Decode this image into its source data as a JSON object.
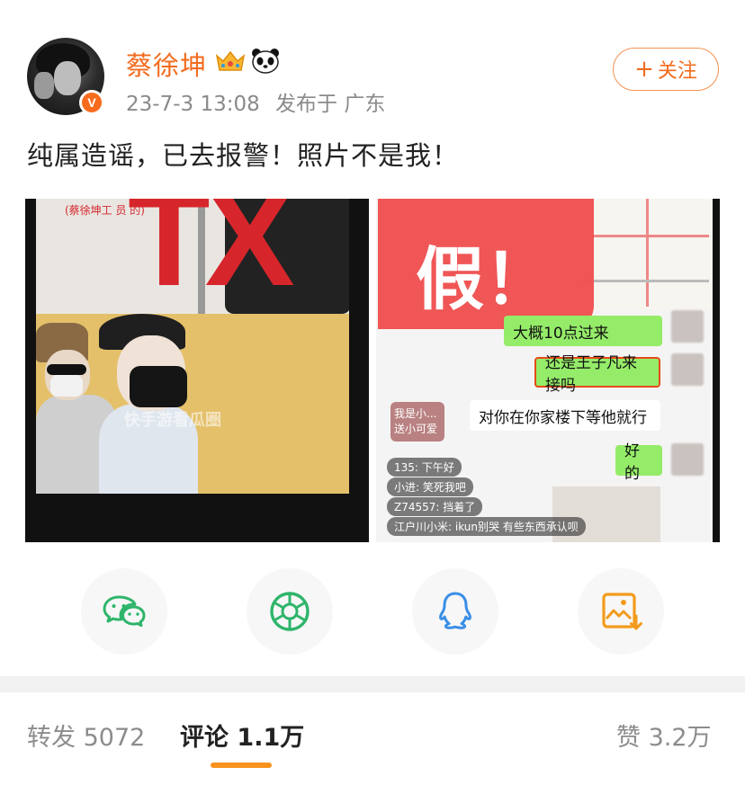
{
  "post": {
    "user": {
      "name": "蔡徐坤",
      "verified_badge": "V",
      "icons": [
        "crown-icon",
        "panda-icon"
      ]
    },
    "timestamp": "23-7-3 13:08",
    "location": "发布于 广东",
    "follow_label": "关注",
    "text": "纯属造谣，已去报警！照片不是我！",
    "images": {
      "image1": {
        "overlay_text": "TX",
        "caption": "(蔡徐坤工    员         的)",
        "watermark": "快手游看瓜圈"
      },
      "image2": {
        "overlay_text": "假！",
        "chat": {
          "green1": "大概10点过来",
          "green2": "还是王子凡来接吗",
          "white1": "对你在你家楼下等他就行",
          "green3": "好的",
          "hint_line1": "我是小...",
          "hint_line2": "送小可爱",
          "live_comments": [
            "135: 下午好",
            "小进: 笑死我吧",
            "Z74557: 挡着了",
            "江户川小米: ikun别哭 有些东西承认呗"
          ]
        }
      }
    }
  },
  "share": {
    "buttons": [
      "wechat-icon",
      "moments-icon",
      "qq-icon",
      "save-image-icon"
    ],
    "colors": {
      "wechat": "#2fb56b",
      "moments": "#2fb56b",
      "qq": "#3a8ee6",
      "save": "#f29b1c"
    }
  },
  "tabs": {
    "repost": {
      "label": "转发",
      "count": "5072"
    },
    "comment": {
      "label": "评论",
      "count": "1.1万"
    },
    "like": {
      "label": "赞",
      "count": "3.2万"
    }
  },
  "colors": {
    "accent": "#f26b1d",
    "tab_underline": "#f7931e"
  }
}
